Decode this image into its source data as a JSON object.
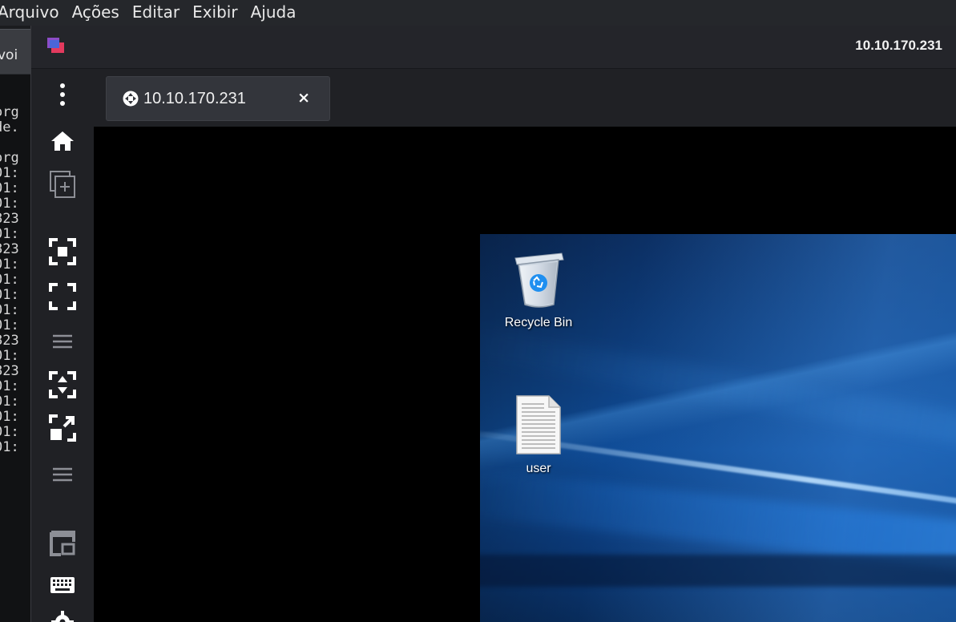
{
  "terminal_menu": {
    "items": [
      "Arquivo",
      "Ações",
      "Editar",
      "Exibir",
      "Ajuda"
    ]
  },
  "terminal": {
    "tab_title_fragment": "voi",
    "lines": [
      "",
      "",
      "org",
      "de.",
      "",
      "org",
      "01:",
      "01:",
      "01:",
      "823",
      "01:",
      "823",
      "01:",
      "01:",
      "01:",
      "01:",
      "01:",
      "823",
      "01:",
      "823",
      "01:",
      "01:",
      "01:",
      "01:",
      "01:"
    ]
  },
  "viewer": {
    "title": "10.10.170.231",
    "tab": {
      "label": "10.10.170.231",
      "close_symbol": "×"
    },
    "toolbar": {
      "icons": [
        "more-vertical-icon",
        "home-icon",
        "new-connection-icon",
        "fit-window-icon",
        "fullscreen-icon",
        "separator-icon",
        "scaling-icon",
        "resize-icon",
        "separator-icon",
        "picture-in-picture-icon",
        "keyboard-icon",
        "settings-icon"
      ]
    }
  },
  "desktop": {
    "icons": [
      {
        "label": "Recycle Bin",
        "icon": "recycle-bin-icon"
      },
      {
        "label": "user",
        "icon": "text-file-icon"
      }
    ]
  },
  "colors": {
    "menubar_bg": "#25272b",
    "viewer_bg": "#202125",
    "tab_bg": "#33353b",
    "desktop_blue": "#0f4b95"
  }
}
